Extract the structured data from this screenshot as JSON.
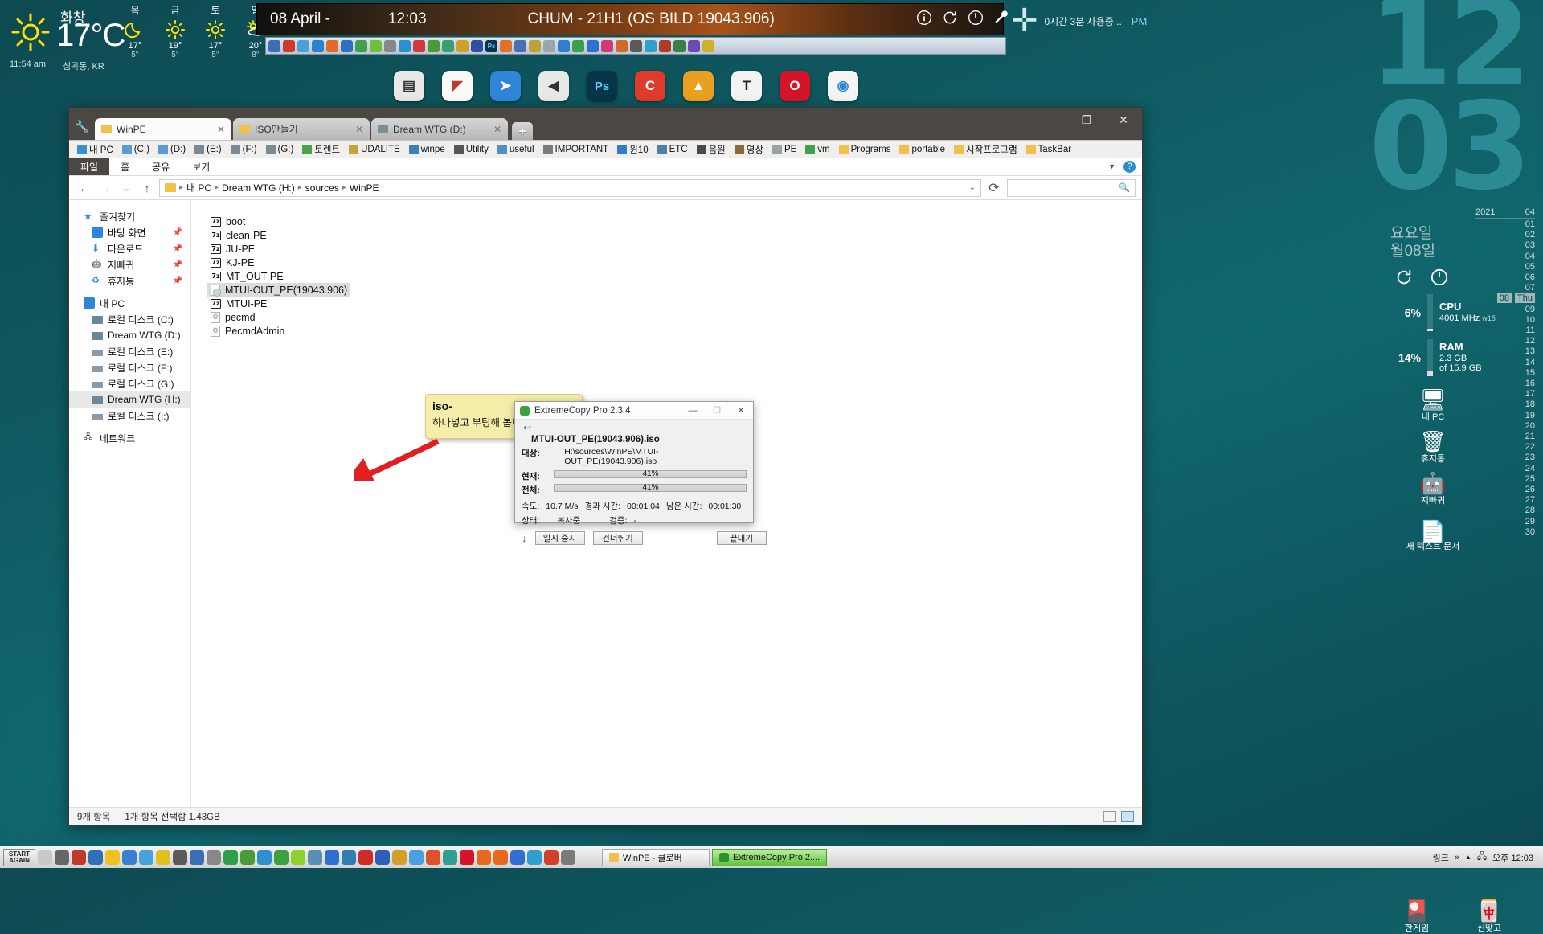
{
  "desktop": {
    "big_clock": [
      "12",
      "03"
    ],
    "weather": {
      "condition": "화창",
      "temperature": "17°C",
      "time": "11:54 am",
      "location": "심곡동, KR",
      "forecast": [
        {
          "day": "목",
          "icon": "moon-icon",
          "high": "17°",
          "low": "5°"
        },
        {
          "day": "금",
          "icon": "sun-icon",
          "high": "19°",
          "low": "5°"
        },
        {
          "day": "토",
          "icon": "sun-icon",
          "high": "17°",
          "low": "5°"
        },
        {
          "day": "일",
          "icon": "sun-cloud-icon",
          "high": "20°",
          "low": "8°"
        }
      ]
    },
    "banner": {
      "date": "08 April -",
      "time": "12:03",
      "title": "CHUM - 21H1 (OS BILD 19043.906)"
    },
    "plus_widget": {
      "usage": "0시간 3분 사용중...",
      "meridiem": "PM"
    }
  },
  "sidebar": {
    "day_lines": [
      "요요일",
      "월08일"
    ],
    "cpu": {
      "percent": "6%",
      "label": "CPU",
      "detail": "4001 MHz"
    },
    "ram": {
      "percent": "14%",
      "label": "RAM",
      "detail_1": "2.3 GB",
      "detail_2": "of 15.9 GB"
    },
    "week_label": "w15",
    "calendar": {
      "year": "2021",
      "month": "04",
      "today": "08",
      "today_weekday": "Thu",
      "days": [
        "01",
        "02",
        "03",
        "04",
        "05",
        "06",
        "07",
        "08",
        "09",
        "10",
        "11",
        "12",
        "13",
        "14",
        "15",
        "16",
        "17",
        "18",
        "19",
        "20",
        "21",
        "22",
        "23",
        "24",
        "25",
        "26",
        "27",
        "28",
        "29",
        "30"
      ]
    },
    "icons": [
      {
        "label": "내 PC",
        "icon": "monitor-icon"
      },
      {
        "label": "휴지통",
        "icon": "recycle-bin-icon"
      },
      {
        "label": "지빠귀",
        "icon": "robot-icon"
      },
      {
        "label": "새 텍스트 문서",
        "icon": "text-file-icon"
      },
      {
        "label": "한게임",
        "icon": "hangame-icon"
      },
      {
        "label": "신맞고",
        "icon": "sinmatgo-icon"
      }
    ]
  },
  "explorer": {
    "tabs": [
      {
        "label": "WinPE",
        "icon": "folder-icon",
        "active": true
      },
      {
        "label": "ISO만들기",
        "icon": "folder-icon",
        "active": false
      },
      {
        "label": "Dream WTG (D:)",
        "icon": "drive-icon",
        "active": false
      }
    ],
    "new_tab_label": "+",
    "window_controls": {
      "minimize": "—",
      "maximize": "❐",
      "close": "✕"
    },
    "bookmarks": [
      {
        "label": "내 PC",
        "icon": "monitor-icon",
        "color": "#3a8fd0"
      },
      {
        "label": "(C:)",
        "icon": "drive-icon",
        "color": "#5a9bd5"
      },
      {
        "label": "(D:)",
        "icon": "drive-icon",
        "color": "#5a9bd5"
      },
      {
        "label": "(E:)",
        "icon": "drive-icon",
        "color": "#7a8a94"
      },
      {
        "label": "(F:)",
        "icon": "drive-icon",
        "color": "#7a8a94"
      },
      {
        "label": "(G:)",
        "icon": "drive-icon",
        "color": "#7a8a94"
      },
      {
        "label": "토렌트",
        "icon": "utorrent-icon",
        "color": "#4aa34a"
      },
      {
        "label": "UDALITE",
        "icon": "app-icon",
        "color": "#c8a23a"
      },
      {
        "label": "winpe",
        "icon": "app-icon",
        "color": "#3a7fc0"
      },
      {
        "label": "Utility",
        "icon": "app-icon",
        "color": "#555555"
      },
      {
        "label": "useful",
        "icon": "app-icon",
        "color": "#4f8fc6"
      },
      {
        "label": "IMPORTANT",
        "icon": "app-icon",
        "color": "#7b7b7b"
      },
      {
        "label": "윈10",
        "icon": "app-icon",
        "color": "#2f7fc4"
      },
      {
        "label": "ETC",
        "icon": "app-icon",
        "color": "#4a7fae"
      },
      {
        "label": "음원",
        "icon": "app-icon",
        "color": "#4b4b4b"
      },
      {
        "label": "영상",
        "icon": "app-icon",
        "color": "#8a6a3a"
      },
      {
        "label": "PE",
        "icon": "app-icon",
        "color": "#9aa3a8"
      },
      {
        "label": "vm",
        "icon": "app-icon",
        "color": "#3f9f4f"
      },
      {
        "label": "Programs",
        "icon": "folder-icon",
        "color": "#f2c14a"
      },
      {
        "label": "portable",
        "icon": "folder-icon",
        "color": "#f2c14a"
      },
      {
        "label": "시작프로그램",
        "icon": "folder-icon",
        "color": "#f2c14a"
      },
      {
        "label": "TaskBar",
        "icon": "folder-icon",
        "color": "#f2c14a"
      }
    ],
    "ribbon_tabs": [
      "파일",
      "홈",
      "공유",
      "보기"
    ],
    "breadcrumb": [
      "내 PC",
      "Dream WTG (H:)",
      "sources",
      "WinPE"
    ],
    "search_placeholder": "",
    "nav_pane": [
      {
        "label": "즐겨찾기",
        "icon": "star-icon",
        "indent": false,
        "pinned": false,
        "selected": false
      },
      {
        "label": "바탕 화면",
        "icon": "desktop-icon",
        "indent": true,
        "pinned": true,
        "selected": false
      },
      {
        "label": "다운로드",
        "icon": "download-icon",
        "indent": true,
        "pinned": true,
        "selected": false
      },
      {
        "label": "지빠귀",
        "icon": "robot-icon",
        "indent": true,
        "pinned": true,
        "selected": false
      },
      {
        "label": "휴지통",
        "icon": "recycle-bin-icon",
        "indent": true,
        "pinned": true,
        "selected": false
      },
      {
        "label": "내 PC",
        "icon": "monitor-icon",
        "indent": false,
        "pinned": false,
        "selected": false
      },
      {
        "label": "로컬 디스크 (C:)",
        "icon": "drive-icon",
        "indent": true,
        "pinned": false,
        "selected": false
      },
      {
        "label": "Dream WTG (D:)",
        "icon": "drive-icon",
        "indent": true,
        "pinned": false,
        "selected": false
      },
      {
        "label": "로컬 디스크 (E:)",
        "icon": "hdd-icon",
        "indent": true,
        "pinned": false,
        "selected": false
      },
      {
        "label": "로컬 디스크 (F:)",
        "icon": "hdd-icon",
        "indent": true,
        "pinned": false,
        "selected": false
      },
      {
        "label": "로컬 디스크 (G:)",
        "icon": "hdd-icon",
        "indent": true,
        "pinned": false,
        "selected": false
      },
      {
        "label": "Dream WTG (H:)",
        "icon": "drive-icon",
        "indent": true,
        "pinned": false,
        "selected": true
      },
      {
        "label": "로컬 디스크 (I:)",
        "icon": "hdd-icon",
        "indent": true,
        "pinned": false,
        "selected": false
      },
      {
        "label": "네트워크",
        "icon": "network-icon",
        "indent": false,
        "pinned": false,
        "selected": false
      }
    ],
    "files": [
      {
        "name": "boot",
        "icon": "7z-icon",
        "selected": false
      },
      {
        "name": "clean-PE",
        "icon": "7z-icon",
        "selected": false
      },
      {
        "name": "JU-PE",
        "icon": "7z-icon",
        "selected": false
      },
      {
        "name": "KJ-PE",
        "icon": "7z-icon",
        "selected": false
      },
      {
        "name": "MT_OUT-PE",
        "icon": "7z-icon",
        "selected": false
      },
      {
        "name": "MTUI-OUT_PE(19043.906)",
        "icon": "disc-image-icon",
        "selected": true
      },
      {
        "name": "MTUI-PE",
        "icon": "7z-icon",
        "selected": false
      },
      {
        "name": "pecmd",
        "icon": "config-file-icon",
        "selected": false
      },
      {
        "name": "PecmdAdmin",
        "icon": "config-file-icon",
        "selected": false
      }
    ],
    "callout": {
      "line1": "iso-",
      "line2": "하나넣고  부팅해 봅니다...."
    },
    "status": {
      "items_count": "9개 항목",
      "selection": "1개 항목 선택함 1.43GB"
    }
  },
  "extremecopy": {
    "title": "ExtremeCopy Pro 2.3.4",
    "controls": {
      "minimize": "—",
      "maximize": "❐",
      "close": "✕"
    },
    "back_arrow": "↩",
    "file_name": "MTUI-OUT_PE(19043.906).iso",
    "target_label": "대상:",
    "target_path": "H:\\sources\\WinPE\\MTUI-OUT_PE(19043.906).iso",
    "current_label": "현재:",
    "current_percent": "41%",
    "current_value": 41,
    "total_label": "전체:",
    "total_percent": "41%",
    "total_value": 41,
    "speed_label": "속도:",
    "speed_value": "10.7 M/s",
    "elapsed_label": "경과 시간:",
    "elapsed_value": "00:01:04",
    "remaining_label": "남은 시간:",
    "remaining_value": "00:01:30",
    "state_label": "상태:",
    "state_value": "복사중",
    "verify_label": "검증:",
    "verify_value": "-",
    "buttons": {
      "pause": "일시 중지",
      "skip": "건너뛰기",
      "finish": "끝내기"
    }
  },
  "taskbar": {
    "start_label_1": "START",
    "start_label_2": "AGAIN",
    "tasks": [
      {
        "label": "WinPE - 클로버",
        "icon": "explorer-icon",
        "active": false
      },
      {
        "label": "ExtremeCopy Pro 2....",
        "icon": "extremecopy-icon",
        "active": true
      }
    ],
    "tray": {
      "links": "링크",
      "chevron": "»",
      "arrow": "▲",
      "network": "network-icon",
      "clock": "오후 12:03"
    }
  }
}
